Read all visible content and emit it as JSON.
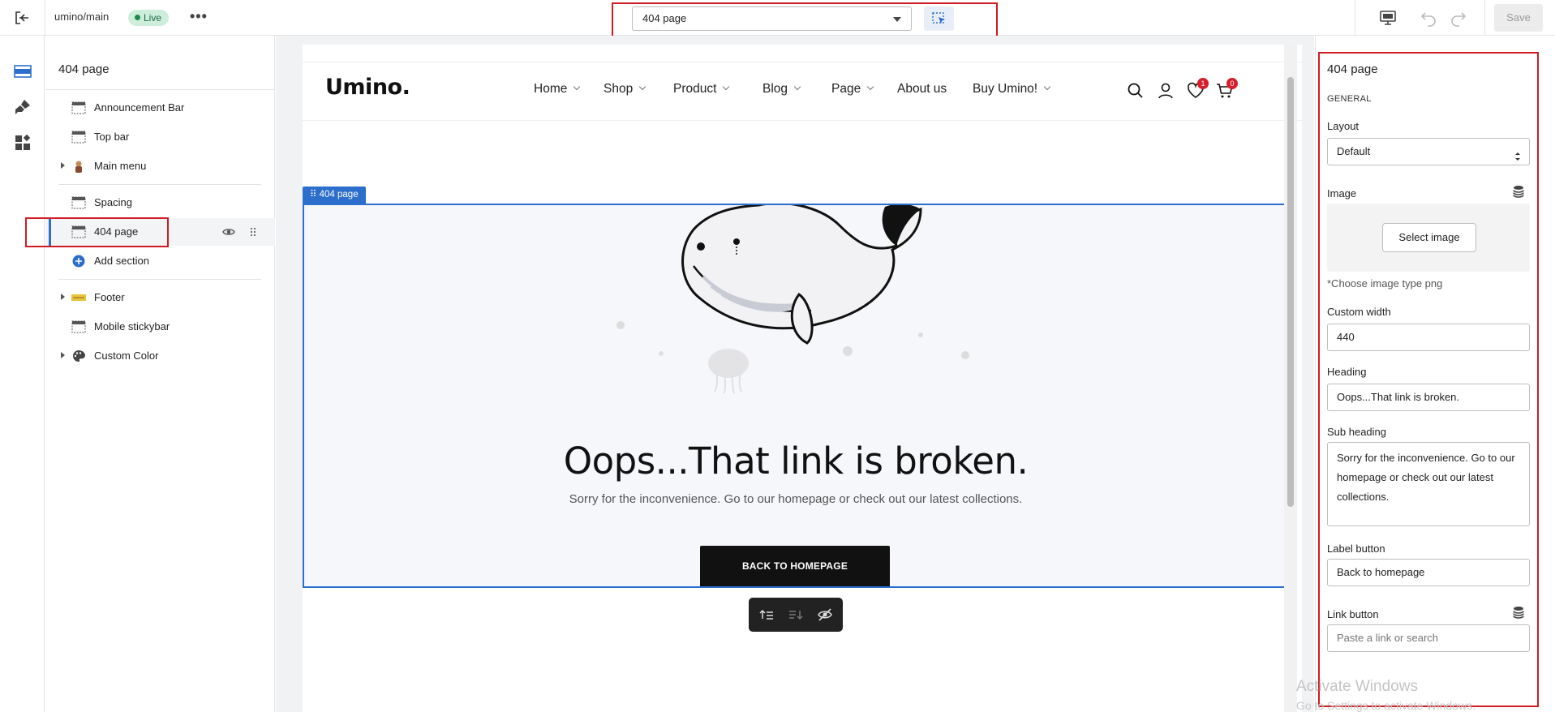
{
  "topbar": {
    "theme_name": "umino/main",
    "status": "Live",
    "page_select": "404 page",
    "save_label": "Save"
  },
  "sections_panel": {
    "title": "404 page",
    "items": [
      {
        "label": "Announcement Bar"
      },
      {
        "label": "Top bar"
      },
      {
        "label": "Main menu"
      },
      {
        "label": "Spacing"
      },
      {
        "label": "404 page"
      },
      {
        "label": "Add section"
      },
      {
        "label": "Footer"
      },
      {
        "label": "Mobile stickybar"
      },
      {
        "label": "Custom Color"
      }
    ]
  },
  "preview": {
    "logo": "Umino.",
    "nav": [
      "Home",
      "Shop",
      "Product",
      "Blog",
      "Page",
      "About us",
      "Buy Umino!"
    ],
    "wishlist_count": "1",
    "cart_count": "0",
    "section_tag": "404 page",
    "heading": "Oops...That link is broken.",
    "subheading": "Sorry for the inconvenience. Go to our homepage or check out our latest collections.",
    "button": "BACK TO HOMEPAGE"
  },
  "settings": {
    "title": "404 page",
    "group": "GENERAL",
    "layout_label": "Layout",
    "layout_value": "Default",
    "image_label": "Image",
    "select_image": "Select image",
    "image_hint": "*Choose image type png",
    "custom_width_label": "Custom width",
    "custom_width_value": "440",
    "heading_label": "Heading",
    "heading_value": "Oops...That link is broken.",
    "subheading_label": "Sub heading",
    "subheading_value": "Sorry for the inconvenience. Go to our homepage or check out our latest collections.",
    "label_button_label": "Label button",
    "label_button_value": "Back to homepage",
    "link_button_label": "Link button",
    "link_button_placeholder": "Paste a link or search"
  },
  "watermark": {
    "line1": "Activate Windows",
    "line2": "Go to Settings to activate Windows."
  },
  "colors": {
    "accent": "#2c6ecb",
    "highlight": "#d01b22",
    "badge": "#d81d2b"
  }
}
